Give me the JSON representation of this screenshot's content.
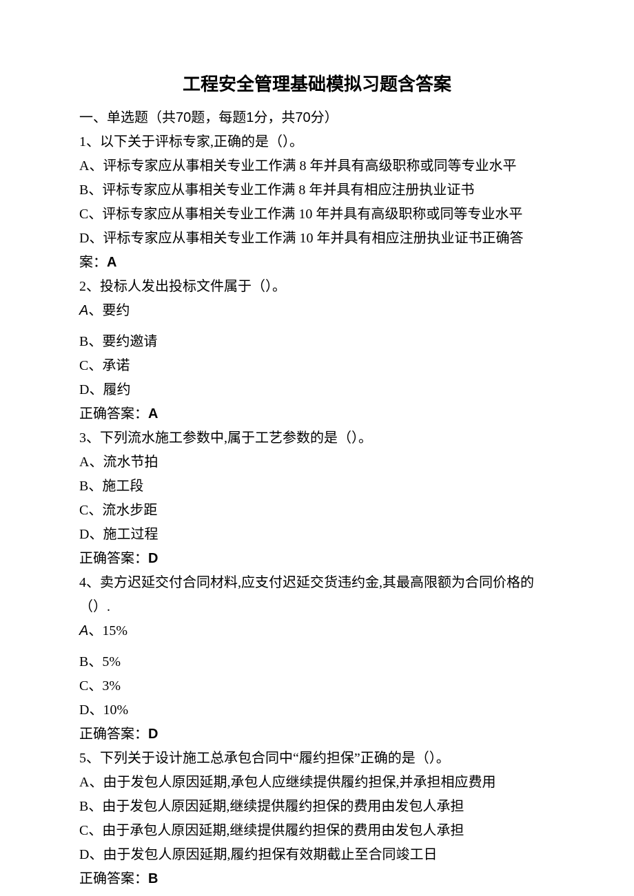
{
  "title": "工程安全管理基础模拟习题含答案",
  "section_heading": {
    "prefix": "一、单选题（共",
    "count1": "70",
    "mid1": "题，每题",
    "pts": "1",
    "mid2": "分，共",
    "total": "70",
    "suffix": "分）"
  },
  "q1": {
    "stem": "1、以下关于评标专家,正确的是（）。",
    "a": "A、评标专家应从事相关专业工作满 8 年并具有高级职称或同等专业水平",
    "b": "B、评标专家应从事相关专业工作满 8 年并具有相应注册执业证书",
    "c": "C、评标专家应从事相关专业工作满 10 年并具有高级职称或同等专业水平",
    "d": "D、评标专家应从事相关专业工作满 10 年并具有相应注册执业证书正确答",
    "ans_label": "案：",
    "ans": "A"
  },
  "q2": {
    "stem": "2、投标人发出投标文件属于（）。",
    "a_label": "A",
    "a_text": "、要约",
    "b": "B、要约邀请",
    "c": "C、承诺",
    "d": "D、履约",
    "ans_label": "正确答案：",
    "ans": "A"
  },
  "q3": {
    "stem": "3、下列流水施工参数中,属于工艺参数的是（）。",
    "a": "A、流水节拍",
    "b": "B、施工段",
    "c": "C、流水步距",
    "d": "D、施工过程",
    "ans_label": "正确答案：",
    "ans": "D"
  },
  "q4": {
    "stem": "4、卖方迟延交付合同材料,应支付迟延交货违约金,其最高限额为合同价格的（）.",
    "a_label": "A",
    "a_text": "、15%",
    "b": "B、5%",
    "c": "C、3%",
    "d": "D、10%",
    "ans_label": "正确答案：",
    "ans": "D"
  },
  "q5": {
    "stem": "5、下列关于设计施工总承包合同中“履约担保”正确的是（）。",
    "a": "A、由于发包人原因延期,承包人应继续提供履约担保,并承担相应费用",
    "b": "B、由于发包人原因延期,继续提供履约担保的费用由发包人承担",
    "c": "C、由于承包人原因延期,继续提供履约担保的费用由发包人承担",
    "d": "D、由于发包人原因延期,履约担保有效期截止至合同竣工日",
    "ans_label": "正确答案：",
    "ans": "B"
  }
}
